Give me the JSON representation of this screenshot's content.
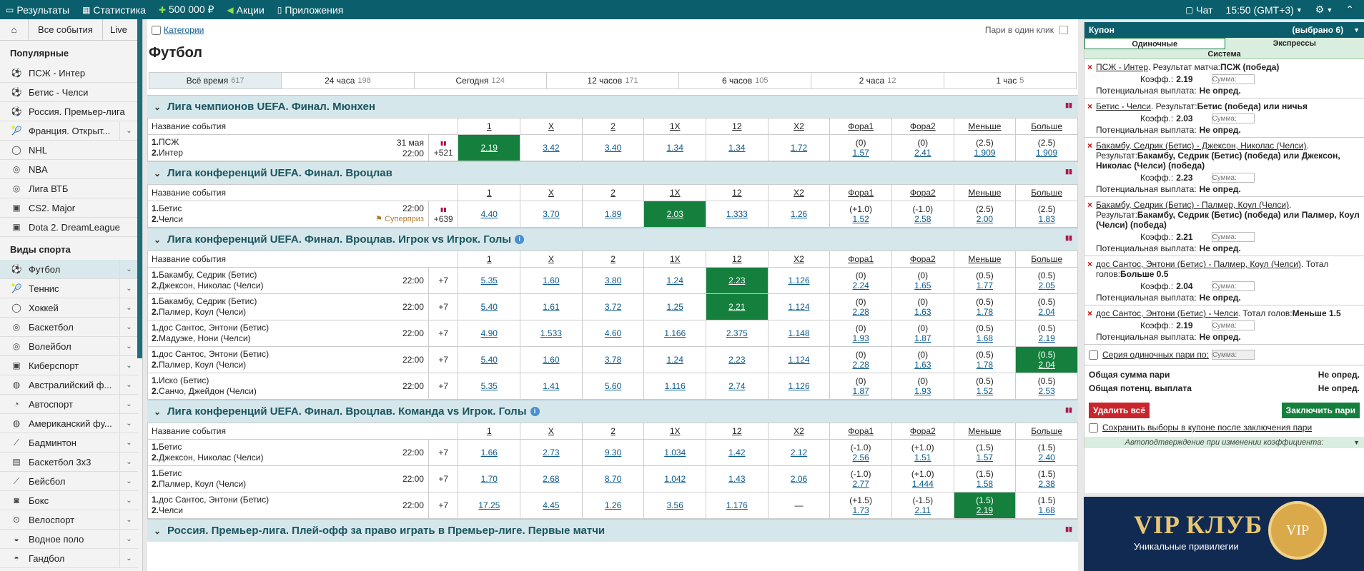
{
  "topbar": {
    "results": "Результаты",
    "stats": "Статистика",
    "bonus": "500 000 ₽",
    "promos": "Акции",
    "apps": "Приложения",
    "chat": "Чат",
    "time": "15:50 (GMT+3)"
  },
  "sidebar": {
    "home": "⌂",
    "all_events": "Все события",
    "live": "Live",
    "popular_title": "Популярные",
    "popular": [
      {
        "label": "ПСЖ - Интер",
        "icon": "soccer-icon",
        "chev": false
      },
      {
        "label": "Бетис - Челси",
        "icon": "soccer-icon",
        "chev": false
      },
      {
        "label": "Россия. Премьер-лига",
        "icon": "soccer-icon",
        "chev": false
      },
      {
        "label": "Франция. Открыт...",
        "icon": "tennis-icon",
        "chev": true
      },
      {
        "label": "NHL",
        "icon": "hockey-icon",
        "chev": false
      },
      {
        "label": "NBA",
        "icon": "basketball-icon",
        "chev": false
      },
      {
        "label": "Лига ВТБ",
        "icon": "basketball-icon",
        "chev": false
      },
      {
        "label": "CS2. Major",
        "icon": "esports-icon",
        "chev": false
      },
      {
        "label": "Dota 2. DreamLeague",
        "icon": "esports-icon",
        "chev": false
      }
    ],
    "sports_title": "Виды спорта",
    "sports": [
      {
        "label": "Футбол",
        "icon": "soccer-icon"
      },
      {
        "label": "Теннис",
        "icon": "tennis-icon"
      },
      {
        "label": "Хоккей",
        "icon": "hockey-icon"
      },
      {
        "label": "Баскетбол",
        "icon": "basketball-icon"
      },
      {
        "label": "Волейбол",
        "icon": "volleyball-icon"
      },
      {
        "label": "Киберспорт",
        "icon": "esports-icon"
      },
      {
        "label": "Австралийский ф...",
        "icon": "aussie-football-icon"
      },
      {
        "label": "Автоспорт",
        "icon": "motorsport-icon"
      },
      {
        "label": "Американский фу...",
        "icon": "american-football-icon"
      },
      {
        "label": "Бадминтон",
        "icon": "badminton-icon"
      },
      {
        "label": "Баскетбол 3x3",
        "icon": "basketball-3x3-icon"
      },
      {
        "label": "Бейсбол",
        "icon": "baseball-icon"
      },
      {
        "label": "Бокс",
        "icon": "boxing-icon"
      },
      {
        "label": "Велоспорт",
        "icon": "cycling-icon"
      },
      {
        "label": "Водное поло",
        "icon": "water-polo-icon"
      },
      {
        "label": "Гандбол",
        "icon": "handball-icon"
      }
    ]
  },
  "main": {
    "categories": "Категории",
    "one_click": "Пари в один клик",
    "title": "Футбол",
    "timefilters": [
      {
        "label": "Всё время",
        "count": "617"
      },
      {
        "label": "24 часа",
        "count": "198"
      },
      {
        "label": "Сегодня",
        "count": "124"
      },
      {
        "label": "12 часов",
        "count": "171"
      },
      {
        "label": "6 часов",
        "count": "105"
      },
      {
        "label": "2 часа",
        "count": "12"
      },
      {
        "label": "1 час",
        "count": "5"
      }
    ],
    "headers": [
      "Название события",
      "1",
      "X",
      "2",
      "1X",
      "12",
      "X2",
      "Фора1",
      "Фора2",
      "Меньше",
      "Больше"
    ],
    "leagues": [
      {
        "title": "Лига чемпионов UEFA. Финал. Мюнхен",
        "info": false,
        "events": [
          {
            "t1": "ПСЖ",
            "t2": "Интер",
            "date": "31 мая",
            "time": "22:00",
            "more": "+521",
            "stats": true,
            "sp": "",
            "odds": [
              "2.19",
              "3.42",
              "3.40",
              "1.34",
              "1.34",
              "1.72"
            ],
            "sel": [
              0
            ],
            "h": [
              [
                "(0)",
                "1.57"
              ],
              [
                "(0)",
                "2.41"
              ],
              [
                "(2.5)",
                "1.909"
              ],
              [
                "(2.5)",
                "1.909"
              ]
            ],
            "hsel": []
          }
        ]
      },
      {
        "title": "Лига конференций UEFA. Финал. Вроцлав",
        "info": false,
        "events": [
          {
            "t1": "Бетис",
            "t2": "Челси",
            "date": "",
            "time": "22:00",
            "more": "+639",
            "stats": true,
            "sp": "Суперприз",
            "odds": [
              "4.40",
              "3.70",
              "1.89",
              "2.03",
              "1.333",
              "1.26"
            ],
            "sel": [
              3
            ],
            "h": [
              [
                "(+1.0)",
                "1.52"
              ],
              [
                "(-1.0)",
                "2.58"
              ],
              [
                "(2.5)",
                "2.00"
              ],
              [
                "(2.5)",
                "1.83"
              ]
            ],
            "hsel": []
          }
        ]
      },
      {
        "title": "Лига конференций UEFA. Финал. Вроцлав. Игрок vs Игрок. Голы",
        "info": true,
        "events": [
          {
            "t1": "Бакамбу, Седрик (Бетис)",
            "t2": "Джексон, Николас (Челси)",
            "date": "",
            "time": "22:00",
            "more": "+7",
            "stats": false,
            "sp": "",
            "odds": [
              "5.35",
              "1.60",
              "3.80",
              "1.24",
              "2.23",
              "1.126"
            ],
            "sel": [
              4
            ],
            "h": [
              [
                "(0)",
                "2.24"
              ],
              [
                "(0)",
                "1.65"
              ],
              [
                "(0.5)",
                "1.77"
              ],
              [
                "(0.5)",
                "2.05"
              ]
            ],
            "hsel": []
          },
          {
            "t1": "Бакамбу, Седрик (Бетис)",
            "t2": "Палмер, Коул (Челси)",
            "date": "",
            "time": "22:00",
            "more": "+7",
            "stats": false,
            "sp": "",
            "odds": [
              "5.40",
              "1.61",
              "3.72",
              "1.25",
              "2.21",
              "1.124"
            ],
            "sel": [
              4
            ],
            "h": [
              [
                "(0)",
                "2.28"
              ],
              [
                "(0)",
                "1.63"
              ],
              [
                "(0.5)",
                "1.78"
              ],
              [
                "(0.5)",
                "2.04"
              ]
            ],
            "hsel": []
          },
          {
            "t1": "дос Сантос, Энтони (Бетис)",
            "t2": "Мадуэке, Нони (Челси)",
            "date": "",
            "time": "22:00",
            "more": "+7",
            "stats": false,
            "sp": "",
            "odds": [
              "4.90",
              "1.533",
              "4.60",
              "1.166",
              "2.375",
              "1.148"
            ],
            "sel": [],
            "h": [
              [
                "(0)",
                "1.93"
              ],
              [
                "(0)",
                "1.87"
              ],
              [
                "(0.5)",
                "1.68"
              ],
              [
                "(0.5)",
                "2.19"
              ]
            ],
            "hsel": []
          },
          {
            "t1": "дос Сантос, Энтони (Бетис)",
            "t2": "Палмер, Коул (Челси)",
            "date": "",
            "time": "22:00",
            "more": "+7",
            "stats": false,
            "sp": "",
            "odds": [
              "5.40",
              "1.60",
              "3.78",
              "1.24",
              "2.23",
              "1.124"
            ],
            "sel": [],
            "h": [
              [
                "(0)",
                "2.28"
              ],
              [
                "(0)",
                "1.63"
              ],
              [
                "(0.5)",
                "1.78"
              ],
              [
                "(0.5)",
                "2.04"
              ]
            ],
            "hsel": [
              3
            ]
          },
          {
            "t1": "Иско (Бетис)",
            "t2": "Санчо, Джейдон (Челси)",
            "date": "",
            "time": "22:00",
            "more": "+7",
            "stats": false,
            "sp": "",
            "odds": [
              "5.35",
              "1.41",
              "5.60",
              "1.116",
              "2.74",
              "1.126"
            ],
            "sel": [],
            "h": [
              [
                "(0)",
                "1.87"
              ],
              [
                "(0)",
                "1.93"
              ],
              [
                "(0.5)",
                "1.52"
              ],
              [
                "(0.5)",
                "2.53"
              ]
            ],
            "hsel": []
          }
        ]
      },
      {
        "title": "Лига конференций UEFA. Финал. Вроцлав. Команда vs Игрок. Голы",
        "info": true,
        "events": [
          {
            "t1": "Бетис",
            "t2": "Джексон, Николас (Челси)",
            "date": "",
            "time": "22:00",
            "more": "+7",
            "stats": false,
            "sp": "",
            "odds": [
              "1.66",
              "2.73",
              "9.30",
              "1.034",
              "1.42",
              "2.12"
            ],
            "sel": [],
            "h": [
              [
                "(-1.0)",
                "2.56"
              ],
              [
                "(+1.0)",
                "1.51"
              ],
              [
                "(1.5)",
                "1.57"
              ],
              [
                "(1.5)",
                "2.40"
              ]
            ],
            "hsel": []
          },
          {
            "t1": "Бетис",
            "t2": "Палмер, Коул (Челси)",
            "date": "",
            "time": "22:00",
            "more": "+7",
            "stats": false,
            "sp": "",
            "odds": [
              "1.70",
              "2.68",
              "8.70",
              "1.042",
              "1.43",
              "2.06"
            ],
            "sel": [],
            "h": [
              [
                "(-1.0)",
                "2.77"
              ],
              [
                "(+1.0)",
                "1.444"
              ],
              [
                "(1.5)",
                "1.58"
              ],
              [
                "(1.5)",
                "2.38"
              ]
            ],
            "hsel": []
          },
          {
            "t1": "дос Сантос, Энтони (Бетис)",
            "t2": "Челси",
            "date": "",
            "time": "22:00",
            "more": "+7",
            "stats": false,
            "sp": "",
            "odds": [
              "17.25",
              "4.45",
              "1.26",
              "3.56",
              "1.176",
              "—"
            ],
            "sel": [],
            "h": [
              [
                "(+1.5)",
                "1.73"
              ],
              [
                "(-1.5)",
                "2.11"
              ],
              [
                "(1.5)",
                "2.19"
              ],
              [
                "(1.5)",
                "1.68"
              ]
            ],
            "hsel": [
              2
            ]
          }
        ]
      },
      {
        "title": "Россия. Премьер-лига. Плей-офф за право играть в Премьер-лиге. Первые матчи",
        "info": false,
        "events": []
      }
    ]
  },
  "coupon": {
    "title": "Купон",
    "count": "(выбрано 6)",
    "tab_single": "Одиночные",
    "tab_express": "Экспрессы",
    "system": "Система",
    "coef_label": "Коэфф.:",
    "payout_label": "Потенциальная выплата:",
    "payout_value": "Не опред.",
    "sum_ph": "Сумма:",
    "bets": [
      {
        "event": "ПСЖ - Интер",
        "pre": ". Результат матча:",
        "result": "ПСЖ (победа)",
        "coef": "2.19"
      },
      {
        "event": "Бетис - Челси",
        "pre": ". Результат:",
        "result": "Бетис (победа) или ничья",
        "coef": "2.03"
      },
      {
        "event": "Бакамбу, Седрик (Бетис) - Джексон, Николас (Челси)",
        "pre": ". Результат:",
        "result": "Бакамбу, Седрик (Бетис) (победа) или Джексон, Николас (Челси) (победа)",
        "coef": "2.23"
      },
      {
        "event": "Бакамбу, Седрик (Бетис) - Палмер, Коул (Челси)",
        "pre": ". Результат:",
        "result": "Бакамбу, Седрик (Бетис) (победа) или Палмер, Коул (Челси) (победа)",
        "coef": "2.21"
      },
      {
        "event": "дос Сантос, Энтони (Бетис) - Палмер, Коул (Челси)",
        "pre": ". Тотал голов:",
        "result": "Больше 0.5",
        "coef": "2.04"
      },
      {
        "event": "дос Сантос, Энтони (Бетис) - Челси",
        "pre": ". Тотал голов:",
        "result": "Меньше 1.5",
        "coef": "2.19"
      }
    ],
    "series": "Серия одиночных пари по:",
    "total_sum": "Общая сумма пари",
    "total_sum_val": "Не опред.",
    "total_payout": "Общая потенц. выплата",
    "total_payout_val": "Не опред.",
    "delete_all": "Удалить всё",
    "place_bet": "Заключить пари",
    "keep": "Сохранить выборы в купоне после заключения пари",
    "auto": "Автоподтверждение при изменении коэффициента:"
  },
  "banner": {
    "title": "VIP КЛУБ",
    "subtitle": "Уникальные привилегии",
    "coin": "VIP"
  }
}
